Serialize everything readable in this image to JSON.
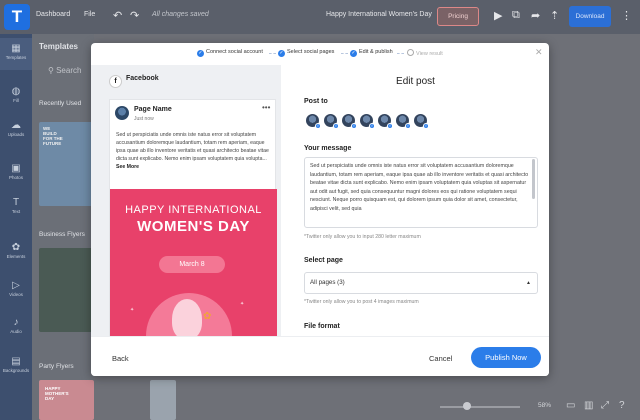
{
  "app": {
    "logo_letter": "T",
    "nav": {
      "dashboard": "Dashboard",
      "file": "File",
      "save_status": "All changes saved"
    },
    "doc_title": "Happy International Women's Day",
    "pricing": "Pricing",
    "download": "Download",
    "sidebar": [
      {
        "label": "Templates",
        "icon": "templates-icon"
      },
      {
        "label": "Fill",
        "icon": "fill-icon"
      },
      {
        "label": "Uploads",
        "icon": "uploads-icon"
      },
      {
        "label": "Photos",
        "icon": "photos-icon"
      },
      {
        "label": "Text",
        "icon": "text-icon"
      },
      {
        "label": "Elements",
        "icon": "elements-icon"
      },
      {
        "label": "Videos",
        "icon": "videos-icon"
      },
      {
        "label": "Audio",
        "icon": "audio-icon"
      },
      {
        "label": "Backgrounds",
        "icon": "backgrounds-icon"
      }
    ],
    "panel": {
      "title": "Templates",
      "search_placeholder": "Search",
      "sections": [
        "Recently Used",
        "Business Flyers",
        "Party Flyers"
      ],
      "thumb_text": "WE BUILD FOR THE FUTURE",
      "party_thumb_text": "HAPPY MOTHER'S DAY"
    },
    "zoom": "58%"
  },
  "modal": {
    "steps": [
      {
        "label": "Connect social account",
        "done": true
      },
      {
        "label": "Select social pages",
        "done": true
      },
      {
        "label": "Edit & publish",
        "done": true
      },
      {
        "label": "View result",
        "done": false
      }
    ],
    "preview": {
      "network": "Facebook",
      "page_name": "Page Name",
      "time": "Just now",
      "text": "Sed ut perspiciatis unde omnis iste natus error sit voluptatem accusantium doloremque laudantium, totam rem aperiam, eaque ipsa quae ab illo inventore veritatis et quasi architecto beatae vitae dicta sunt explicabo. Nemo enim ipsam voluptatem quia voluptas sit aspernatur aut odit aut fugit, sed quia consequuntur magni dolores eos qui ratione voluptatem sequi nesciunt. Neque porro quisquam est, qui dolorem ipsum quia dolor sit amet, consectetur, adipisci velit, sed quia",
      "text_short": "Sed ut perspiciatis unde omnis iste natus error sit voluptatem accusantium doloremque laudantium, totam rem aperiam, eaque ipsa quae ab illo inventore veritatis et quasi architecto beatae vitae dicta sunt explicabo. Nemo enim ipsam voluptatem quia volupta...",
      "see_more": "See More",
      "image_line1": "HAPPY INTERNATIONAL",
      "image_line2": "WOMEN'S DAY",
      "image_date": "March 8"
    },
    "title": "Edit post",
    "post_to_label": "Post to",
    "account_count": 7,
    "message_label": "Your message",
    "message": "Sed ut perspiciatis unde omnis iste natus error sit voluptatem accusantium doloremque laudantium, totam rem aperiam, eaque ipsa quae ab illo inventore veritatis et quasi architecto beatae vitae dicta sunt explicabo. Nemo enim ipsam voluptatem quia voluptas sit aspernatur aut odit aut fugit, sed quia consequuntur magni dolores eos qui ratione voluptatem sequi nesciunt. Neque porro quisquam est, qui dolorem ipsum quia dolor sit amet, consectetur, adipisci velit, sed quia",
    "message_hint": "*Twitter only allow you to input 280 letter maximum",
    "select_page_label": "Select page",
    "select_page_value": "All pages (3)",
    "select_page_hint": "*Twitter only allow you to post 4 images maximum",
    "file_format_label": "File format",
    "back": "Back",
    "cancel": "Cancel",
    "publish": "Publish Now"
  }
}
